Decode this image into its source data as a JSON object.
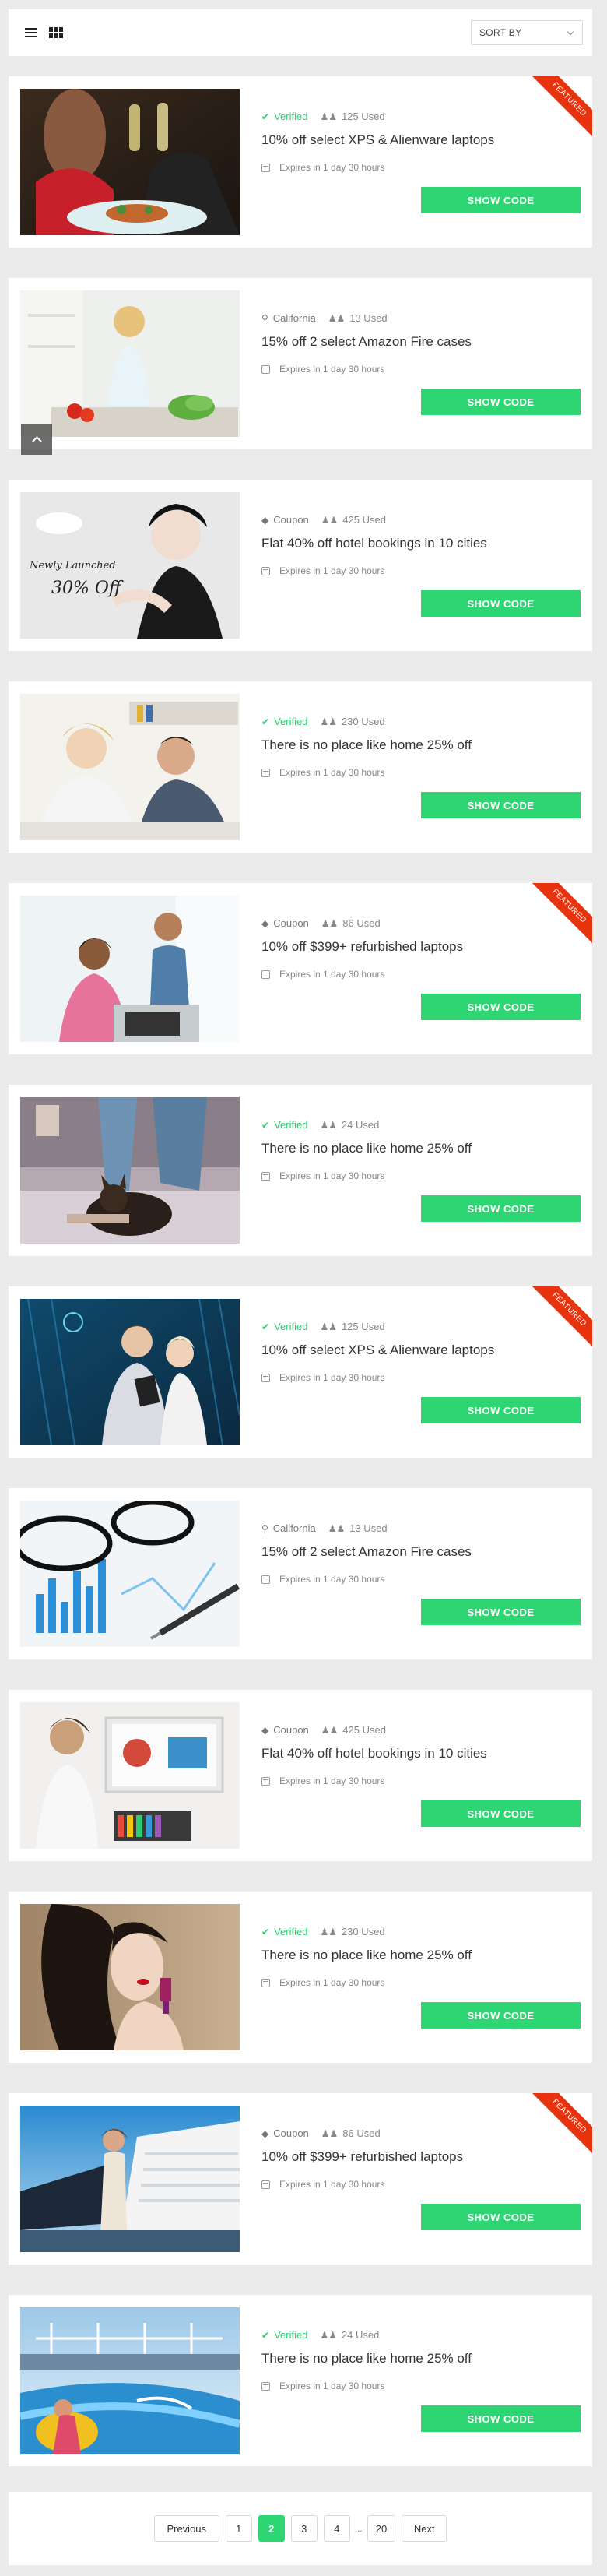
{
  "toolbar": {
    "list_view_icon": "list-icon",
    "grid_view_icon": "grid-icon",
    "sort_label": "SORT BY"
  },
  "colors": {
    "accent": "#2ed573",
    "featured": "#e8330f",
    "verified": "#2ecc71"
  },
  "button_label": "SHOW CODE",
  "ribbon_label": "FEATURED",
  "expires_text": "Expires in 1 day 30 hours",
  "coupons": [
    {
      "tag": "Verified",
      "tag_icon": "check-circle-icon",
      "used": "125 Used",
      "title": "10% off select XPS & Alienware laptops",
      "featured": true,
      "image": "dinner-toast-photo"
    },
    {
      "tag": "California",
      "tag_icon": "map-pin-icon",
      "used": "13 Used",
      "title": "15% off 2 select Amazon Fire cases",
      "featured": false,
      "image": "kitchen-salad-photo"
    },
    {
      "tag": "Coupon",
      "tag_icon": "tag-icon",
      "used": "425 Used",
      "title": "Flat 40% off hotel bookings in 10 cities",
      "featured": false,
      "image": "fashion-sale-banner",
      "image_text_1": "Newly Launched",
      "image_text_2": "30% Off"
    },
    {
      "tag": "Verified",
      "tag_icon": "check-circle-icon",
      "used": "230 Used",
      "title": "There is no place like home 25% off",
      "featured": false,
      "image": "couple-sofa-photo"
    },
    {
      "tag": "Coupon",
      "tag_icon": "tag-icon",
      "used": "86 Used",
      "title": "10% off $399+ refurbished laptops",
      "featured": true,
      "image": "couple-laptop-photo"
    },
    {
      "tag": "Verified",
      "tag_icon": "check-circle-icon",
      "used": "24 Used",
      "title": "There is no place like home 25% off",
      "featured": false,
      "image": "dog-bed-photo"
    },
    {
      "tag": "Verified",
      "tag_icon": "check-circle-icon",
      "used": "125 Used",
      "title": "10% off select XPS & Alienware laptops",
      "featured": true,
      "image": "business-tablet-photo"
    },
    {
      "tag": "California",
      "tag_icon": "map-pin-icon",
      "used": "13 Used",
      "title": "15% off 2 select Amazon Fire cases",
      "featured": false,
      "image": "glasses-chart-photo"
    },
    {
      "tag": "Coupon",
      "tag_icon": "tag-icon",
      "used": "425 Used",
      "title": "Flat 40% off hotel bookings in 10 cities",
      "featured": false,
      "image": "designer-desk-photo"
    },
    {
      "tag": "Verified",
      "tag_icon": "check-circle-icon",
      "used": "230 Used",
      "title": "There is no place like home 25% off",
      "featured": false,
      "image": "woman-earring-photo"
    },
    {
      "tag": "Coupon",
      "tag_icon": "tag-icon",
      "used": "86 Used",
      "title": "10% off $399+ refurbished laptops",
      "featured": true,
      "image": "cruise-woman-photo"
    },
    {
      "tag": "Verified",
      "tag_icon": "check-circle-icon",
      "used": "24 Used",
      "title": "There is no place like home 25% off",
      "featured": false,
      "image": "waterslide-photo"
    }
  ],
  "pagination": {
    "prev": "Previous",
    "pages": [
      "1",
      "2",
      "3",
      "4"
    ],
    "active": "2",
    "ellipsis": "...",
    "last": "20",
    "next": "Next"
  }
}
